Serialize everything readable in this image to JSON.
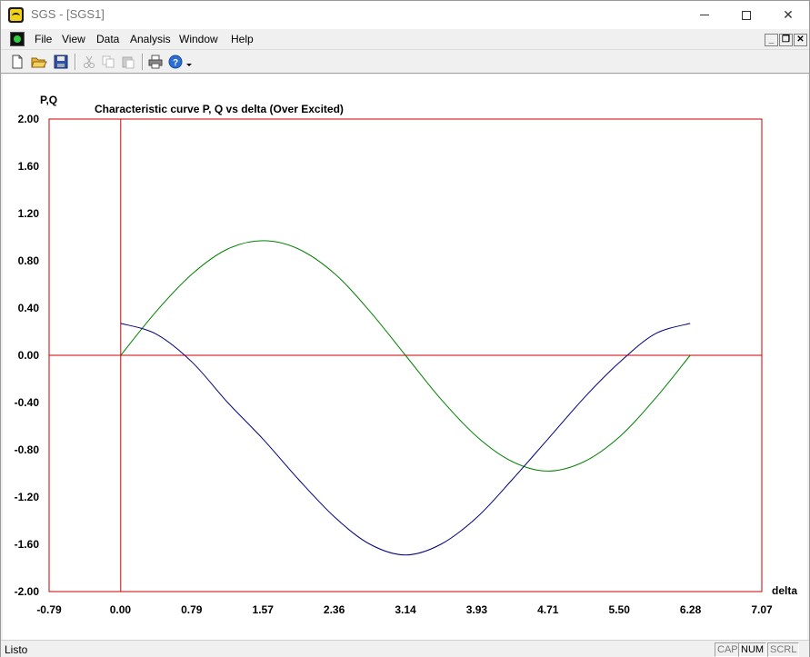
{
  "window": {
    "title": "SGS - [SGS1]"
  },
  "menu": {
    "items": [
      "File",
      "View",
      "Data",
      "Analysis",
      "Window",
      "Help"
    ]
  },
  "toolbar": {
    "buttons": [
      "new-icon",
      "open-icon",
      "save-icon",
      "cut-icon",
      "copy-icon",
      "paste-icon",
      "print-icon",
      "help-icon"
    ]
  },
  "status": {
    "text": "Listo",
    "cap": "CAP",
    "num": "NUM",
    "scrl": "SCRL"
  },
  "colors": {
    "axis": "#cc0000",
    "series_q": "#000080",
    "series_p": "#008000"
  },
  "chart_data": {
    "type": "line",
    "title": "Characteristic curve P, Q vs delta (Over Excited)",
    "xlabel": "delta",
    "ylabel": "P,Q",
    "xlim": [
      -0.79,
      7.07
    ],
    "ylim": [
      -2.0,
      2.0
    ],
    "x_ticks": [
      "-0.79",
      "0.00",
      "0.79",
      "1.57",
      "2.36",
      "3.14",
      "3.93",
      "4.71",
      "5.50",
      "6.28",
      "7.07"
    ],
    "y_ticks": [
      "2.00",
      "1.60",
      "1.20",
      "0.80",
      "0.40",
      "0.00",
      "-0.40",
      "-0.80",
      "-1.20",
      "-1.60",
      "-2.00"
    ],
    "series": [
      {
        "color": "#008000",
        "x": [
          0.0,
          0.39,
          0.79,
          1.18,
          1.57,
          1.96,
          2.36,
          2.75,
          3.14,
          3.53,
          3.93,
          4.32,
          4.71,
          5.11,
          5.5,
          5.89,
          6.28
        ],
        "y": [
          0.0,
          0.37,
          0.69,
          0.9,
          0.97,
          0.9,
          0.69,
          0.37,
          0.0,
          -0.37,
          -0.69,
          -0.9,
          -0.98,
          -0.9,
          -0.69,
          -0.37,
          0.0
        ]
      },
      {
        "color": "#000080",
        "x": [
          0.0,
          0.39,
          0.79,
          1.18,
          1.57,
          1.96,
          2.36,
          2.75,
          3.14,
          3.53,
          3.93,
          4.32,
          4.71,
          5.11,
          5.5,
          5.89,
          6.28
        ],
        "y": [
          0.27,
          0.18,
          -0.06,
          -0.4,
          -0.71,
          -1.05,
          -1.37,
          -1.6,
          -1.69,
          -1.6,
          -1.37,
          -1.05,
          -0.71,
          -0.36,
          -0.06,
          0.18,
          0.27
        ]
      }
    ]
  }
}
